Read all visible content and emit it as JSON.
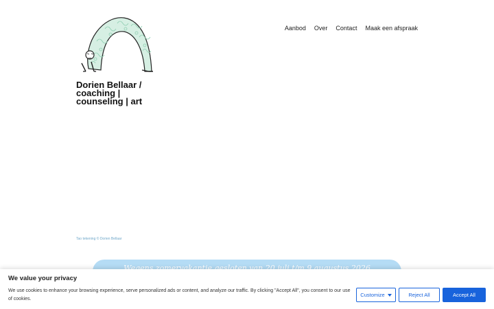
{
  "site": {
    "title": "Dorien Bellaar / coaching | counseling | art"
  },
  "nav": {
    "items": [
      {
        "label": "Aanbod"
      },
      {
        "label": "Over"
      },
      {
        "label": "Contact"
      },
      {
        "label": "Maak een afspraak"
      }
    ]
  },
  "hero": {
    "caption": "Tao tekening © Dorien Bellaar"
  },
  "banner": {
    "text": "Wegens zomervakantie gesloten van 20 juli t/m 9 augustus 2026"
  },
  "cookie": {
    "title": "We value your privacy",
    "text": "We use cookies to enhance your browsing experience, serve personalized ads or content, and analyze our traffic. By clicking \"Accept All\", you consent to our use of cookies.",
    "customize_label": "Customize",
    "reject_label": "Reject All",
    "accept_label": "Accept All"
  },
  "colors": {
    "accent": "#1863dc",
    "banner": "#b5dcf5",
    "logo_pattern": "#8fcfb2"
  },
  "icons": {
    "logo": "yoga-figure-logo",
    "customize": "caret-down-icon"
  }
}
